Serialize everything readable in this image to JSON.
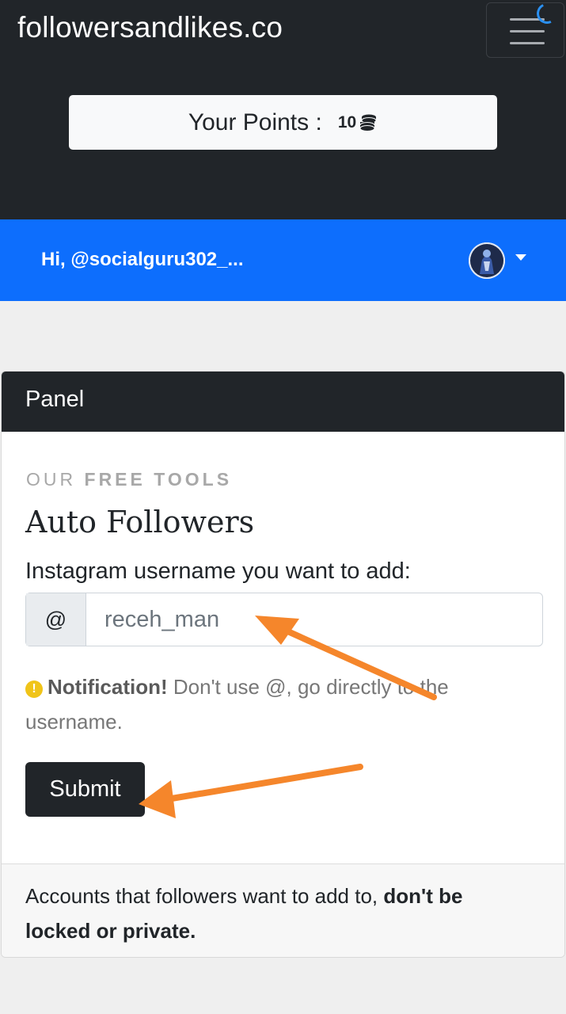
{
  "navbar": {
    "brand": "followersandlikes.co",
    "menu_icon": "hamburger-menu-icon",
    "loading_icon": "loading-spinner-icon"
  },
  "points": {
    "label": "Your Points :",
    "value": "10",
    "icon": "coins-stack-icon"
  },
  "user": {
    "greeting": "Hi, @socialguru302_...",
    "avatar_icon": "user-avatar",
    "dropdown_icon": "caret-down-icon"
  },
  "panel": {
    "header": "Panel",
    "eyebrow_light": "OUR",
    "eyebrow_bold": "FREE TOOLS",
    "title": "Auto Followers",
    "field_label": "Instagram username you want to add:",
    "addon": "@",
    "username_value": "receh_man",
    "notice_bold": "Notification!",
    "notice_text": " Don't use @, go directly to the username.",
    "submit_label": "Submit",
    "footer_text": "Accounts that followers want to add to, ",
    "footer_bold": "don't be locked or private."
  },
  "colors": {
    "navbar_bg": "#212529",
    "userbar_bg": "#0d6efd",
    "annotation_arrow": "#f5862b",
    "notice_icon": "#f0c419"
  }
}
